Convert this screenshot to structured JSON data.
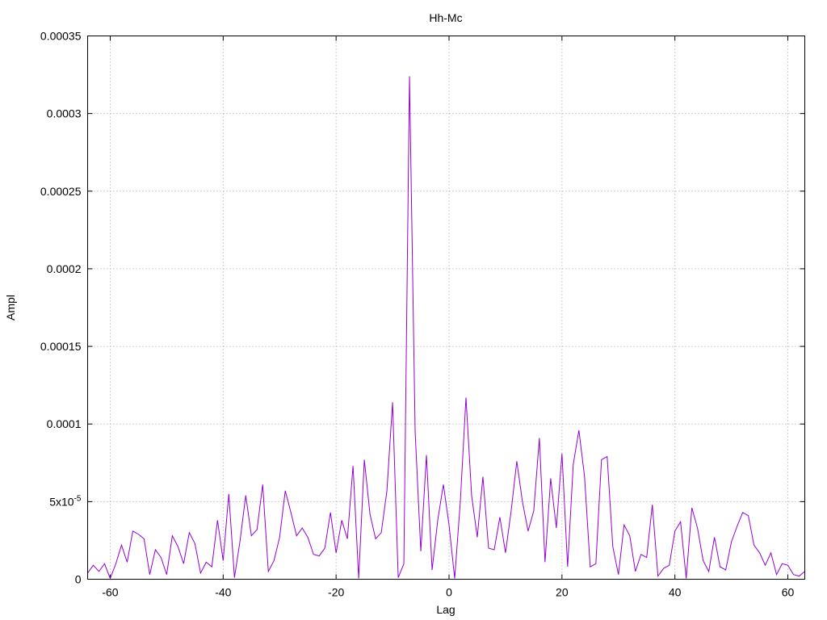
{
  "chart_data": {
    "type": "line",
    "title": "Hh-Mc",
    "xlabel": "Lag",
    "ylabel": "Ampl",
    "xlim": [
      -64,
      63
    ],
    "ylim": [
      0,
      0.00035
    ],
    "grid": true,
    "line_color": "#9400d3",
    "x_ticks": [
      -60,
      -40,
      -20,
      0,
      20,
      40,
      60
    ],
    "x_tick_labels": [
      "-60",
      "-40",
      "-20",
      "0",
      "20",
      "40",
      "60"
    ],
    "y_ticks": [
      0,
      5e-05,
      0.0001,
      0.00015,
      0.0002,
      0.00025,
      0.0003,
      0.00035
    ],
    "y_tick_labels": [
      "0",
      "5x10",
      "0.0001",
      "0.00015",
      "0.0002",
      "0.00025",
      "0.0003",
      "0.00035"
    ],
    "y_tick_exponent": "-5",
    "series": [
      {
        "x": [
          -64,
          -63,
          -62,
          -61,
          -60,
          -59,
          -58,
          -57,
          -56,
          -55,
          -54,
          -53,
          -52,
          -51,
          -50,
          -49,
          -48,
          -47,
          -46,
          -45,
          -44,
          -43,
          -42,
          -41,
          -40,
          -39,
          -38,
          -37,
          -36,
          -35,
          -34,
          -33,
          -32,
          -31,
          -30,
          -29,
          -28,
          -27,
          -26,
          -25,
          -24,
          -23,
          -22,
          -21,
          -20,
          -19,
          -18,
          -17,
          -16,
          -15,
          -14,
          -13,
          -12,
          -11,
          -10,
          -9,
          -8,
          -7,
          -6,
          -5,
          -4,
          -3,
          -2,
          -1,
          0,
          1,
          2,
          3,
          4,
          5,
          6,
          7,
          8,
          9,
          10,
          11,
          12,
          13,
          14,
          15,
          16,
          17,
          18,
          19,
          20,
          21,
          22,
          23,
          24,
          25,
          26,
          27,
          28,
          29,
          30,
          31,
          32,
          33,
          34,
          35,
          36,
          37,
          38,
          39,
          40,
          41,
          42,
          43,
          44,
          45,
          46,
          47,
          48,
          49,
          50,
          51,
          52,
          53,
          54,
          55,
          56,
          57,
          58,
          59,
          60,
          61,
          62,
          63
        ],
        "values": [
          4e-06,
          9e-06,
          5e-06,
          1e-05,
          5e-07,
          1e-05,
          2.2e-05,
          1.1e-05,
          3.1e-05,
          2.9e-05,
          2.6e-05,
          3e-06,
          1.9e-05,
          1.4e-05,
          3e-06,
          2.8e-05,
          2.1e-05,
          1e-05,
          3e-05,
          2.3e-05,
          4e-06,
          1.1e-05,
          8e-06,
          3.8e-05,
          1.2e-05,
          5.5e-05,
          1e-06,
          2.5e-05,
          5.4e-05,
          2.8e-05,
          3.2e-05,
          6.1e-05,
          5e-06,
          1.2e-05,
          2.7e-05,
          5.7e-05,
          4.3e-05,
          2.8e-05,
          3.3e-05,
          2.7e-05,
          1.6e-05,
          1.5e-05,
          2e-05,
          4.3e-05,
          1.7e-05,
          3.8e-05,
          2.6e-05,
          7.3e-05,
          5e-07,
          7.7e-05,
          4.2e-05,
          2.6e-05,
          3e-05,
          5.7e-05,
          0.000114,
          1e-06,
          1e-05,
          0.000324,
          9.5e-05,
          1.8e-05,
          8e-05,
          6e-06,
          3.8e-05,
          6.1e-05,
          3.5e-05,
          5e-07,
          5e-05,
          0.000117,
          5.4e-05,
          2.7e-05,
          6.6e-05,
          2e-05,
          1.9e-05,
          4e-05,
          1.7e-05,
          4.4e-05,
          7.6e-05,
          5e-05,
          3.1e-05,
          4.4e-05,
          9.1e-05,
          1.1e-05,
          6.5e-05,
          3.3e-05,
          8.1e-05,
          8e-06,
          7.4e-05,
          9.6e-05,
          6.6e-05,
          8e-06,
          1e-05,
          7.7e-05,
          7.9e-05,
          2.1e-05,
          3e-06,
          3.5e-05,
          2.8e-05,
          5e-06,
          1.6e-05,
          1.4e-05,
          4.8e-05,
          2e-06,
          7e-06,
          9e-06,
          3.1e-05,
          3.7e-05,
          5e-07,
          4.6e-05,
          3.3e-05,
          1.2e-05,
          5e-06,
          2.7e-05,
          8e-06,
          6e-06,
          2.4e-05,
          3.4e-05,
          4.3e-05,
          4.1e-05,
          2.2e-05,
          1.7e-05,
          9e-06,
          1.7e-05,
          3e-06,
          1e-05,
          9e-06,
          3e-06,
          2e-06,
          5e-06
        ]
      }
    ]
  }
}
